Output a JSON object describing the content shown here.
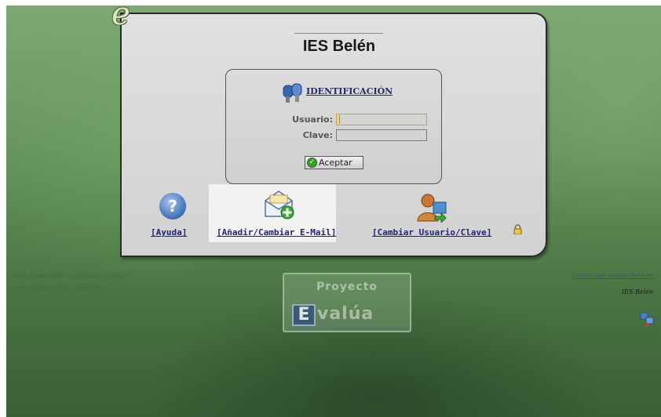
{
  "header": {
    "logo_letter": "e",
    "title": "IES Belén"
  },
  "login": {
    "section_title": "IDENTIFICACIÓN",
    "user_label": "Usuario:",
    "password_label": "Clave:",
    "user_value": "",
    "password_value": "",
    "accept_label": "Aceptar",
    "accept_icon": "check-icon",
    "section_icon": "keys-icon"
  },
  "actions": {
    "help_label": "[Ayuda]",
    "help_glyph": "?",
    "email_label": "[Añadir/Cambiar E-Mail]",
    "change_label": "[Cambiar Usuario/Clave]"
  },
  "footer": {
    "last_update": "Última actualización : 22/09/2010 15:49:12",
    "system_version": "Sistema Evalúa v.6.45 - 2002-2011",
    "admin_link": "Admin : José Antonio Peña Pér",
    "school": "IES Belén"
  },
  "brand": {
    "word1": "Proyecto",
    "e_letter": "E",
    "word2": "valúa"
  },
  "colors": {
    "background": "#5f8e56",
    "panel": "#d8d8d8",
    "link": "#22227a",
    "highlight": "#f2f2f2"
  }
}
